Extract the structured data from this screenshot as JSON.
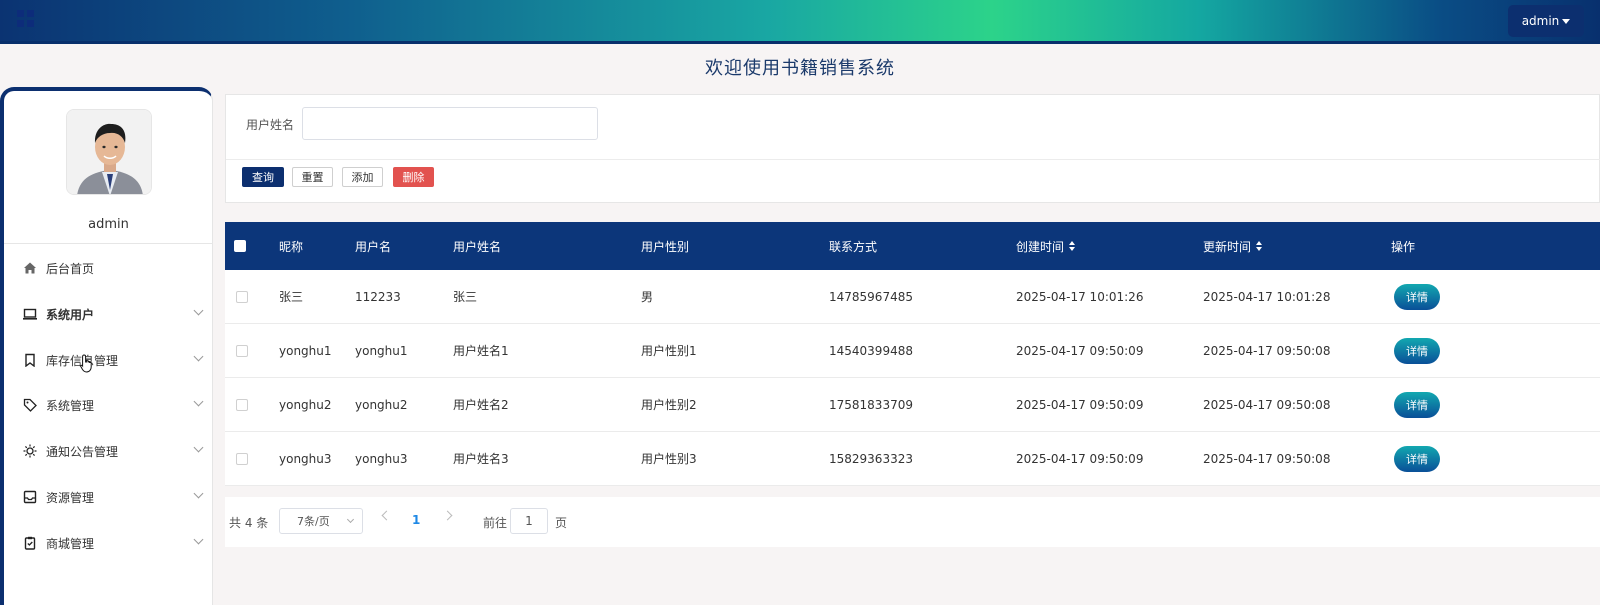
{
  "header": {
    "user_menu_label": "admin"
  },
  "page_title": "欢迎使用书籍销售系统",
  "sidebar": {
    "user_name": "admin",
    "items": [
      {
        "label": "后台首页",
        "icon": "home-icon",
        "has_submenu": false,
        "bold": false
      },
      {
        "label": "系统用户",
        "icon": "laptop-icon",
        "has_submenu": true,
        "bold": true
      },
      {
        "label": "库存信息管理",
        "icon": "bookmark-icon",
        "has_submenu": true,
        "bold": false
      },
      {
        "label": "系统管理",
        "icon": "tag-icon",
        "has_submenu": true,
        "bold": false
      },
      {
        "label": "通知公告管理",
        "icon": "sun-icon",
        "has_submenu": true,
        "bold": false
      },
      {
        "label": "资源管理",
        "icon": "inbox-icon",
        "has_submenu": true,
        "bold": false
      },
      {
        "label": "商城管理",
        "icon": "clipboard-icon",
        "has_submenu": true,
        "bold": false
      }
    ]
  },
  "search": {
    "label": "用户姓名",
    "value": "",
    "placeholder": "",
    "buttons": {
      "query": "查询",
      "reset": "重置",
      "add": "添加",
      "delete": "删除"
    }
  },
  "table": {
    "columns": [
      "昵称",
      "用户名",
      "用户姓名",
      "用户性别",
      "联系方式",
      "创建时间",
      "更新时间",
      "操作"
    ],
    "rows": [
      {
        "nickname": "张三",
        "username": "112233",
        "realname": "张三",
        "gender": "男",
        "phone": "14785967485",
        "created": "2025-04-17 10:01:26",
        "updated": "2025-04-17 10:01:28",
        "action": "详情"
      },
      {
        "nickname": "yonghu1",
        "username": "yonghu1",
        "realname": "用户姓名1",
        "gender": "用户性别1",
        "phone": "14540399488",
        "created": "2025-04-17 09:50:09",
        "updated": "2025-04-17 09:50:08",
        "action": "详情"
      },
      {
        "nickname": "yonghu2",
        "username": "yonghu2",
        "realname": "用户姓名2",
        "gender": "用户性别2",
        "phone": "17581833709",
        "created": "2025-04-17 09:50:09",
        "updated": "2025-04-17 09:50:08",
        "action": "详情"
      },
      {
        "nickname": "yonghu3",
        "username": "yonghu3",
        "realname": "用户姓名3",
        "gender": "用户性别3",
        "phone": "15829363323",
        "created": "2025-04-17 09:50:09",
        "updated": "2025-04-17 09:50:08",
        "action": "详情"
      }
    ]
  },
  "pagination": {
    "total_text": "共 4 条",
    "page_size": "7条/页",
    "current_page": "1",
    "goto_label": "前往",
    "goto_value": "1",
    "page_suffix": "页"
  },
  "colors": {
    "primary": "#0c2f6f",
    "table_header": "#0c367a",
    "danger": "#e2524f",
    "page_bg": "#f7f4f4"
  }
}
